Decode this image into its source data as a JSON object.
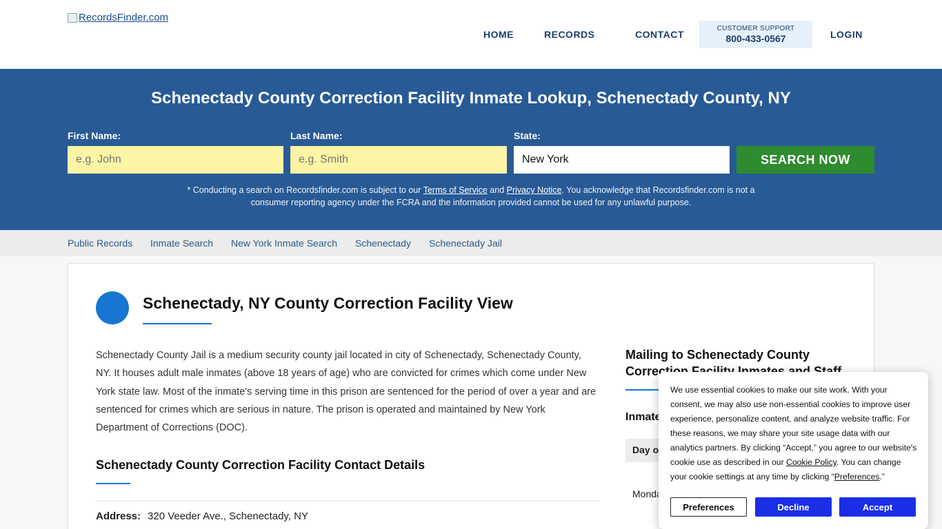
{
  "header": {
    "logo_alt": "RecordsFinder.com",
    "nav": {
      "home": "HOME",
      "records": "RECORDS",
      "contact": "CONTACT",
      "login": "LOGIN"
    },
    "support_label": "CUSTOMER SUPPORT",
    "support_phone": "800-433-0567"
  },
  "hero": {
    "title": "Schenectady County Correction Facility Inmate Lookup, Schenectady County, NY",
    "first_name_label": "First Name:",
    "first_name_placeholder": "e.g. John",
    "last_name_label": "Last Name:",
    "last_name_placeholder": "e.g. Smith",
    "state_label": "State:",
    "state_value": "New York",
    "search_button": "SEARCH NOW",
    "disclaimer_1": "* Conducting a search on Recordsfinder.com is subject to our ",
    "terms_link": "Terms of Service",
    "disclaimer_and": " and ",
    "privacy_link": "Privacy Notice",
    "disclaimer_2": ". You acknowledge that Recordsfinder.com is not a consumer reporting agency under the FCRA and the information provided cannot be used for any unlawful purpose."
  },
  "breadcrumbs": [
    "Public Records",
    "Inmate Search",
    "New York Inmate Search",
    "Schenectady",
    "Schenectady Jail"
  ],
  "main": {
    "title": "Schenectady, NY County Correction Facility View",
    "description": "Schenectady County Jail is a medium security county jail located in city of Schenectady, Schenectady County, NY. It houses adult male inmates (above 18 years of age) who are convicted for crimes which come under New York state law. Most of the inmate's serving time in this prison are sentenced for the period of over a year and are sentenced for crimes which are serious in nature. The prison is operated and maintained by New York Department of Corrections (DOC).",
    "contact_heading": "Schenectady County Correction Facility Contact Details",
    "address_label": "Address:",
    "address_value": "320 Veeder Ave., Schenectady, NY"
  },
  "sidebar": {
    "heading": "Mailing to Schenectady County Correction Facility Inmates and Staff",
    "subheading": "Inmate",
    "table_header": "Day of",
    "table_cell": "Monday"
  },
  "cookie": {
    "text_1": "We use essential cookies to make our site work. With your consent, we may also use non-essential cookies to improve user experience, personalize content, and analyze website traffic. For these reasons, we may share your site usage data with our analytics partners. By clicking “Accept,” you agree to our website's cookie use as described in our ",
    "policy_link": "Cookie Policy",
    "text_2": ". You can change your cookie settings at any time by clicking “",
    "pref_link": "Preferences",
    "text_3": ".”",
    "btn_preferences": "Preferences",
    "btn_decline": "Decline",
    "btn_accept": "Accept"
  },
  "colors": {
    "hero_bg": "#285a96",
    "search_button": "#2e8b2e",
    "accent_blue": "#1676d2",
    "cookie_button": "#1a2ee6"
  }
}
